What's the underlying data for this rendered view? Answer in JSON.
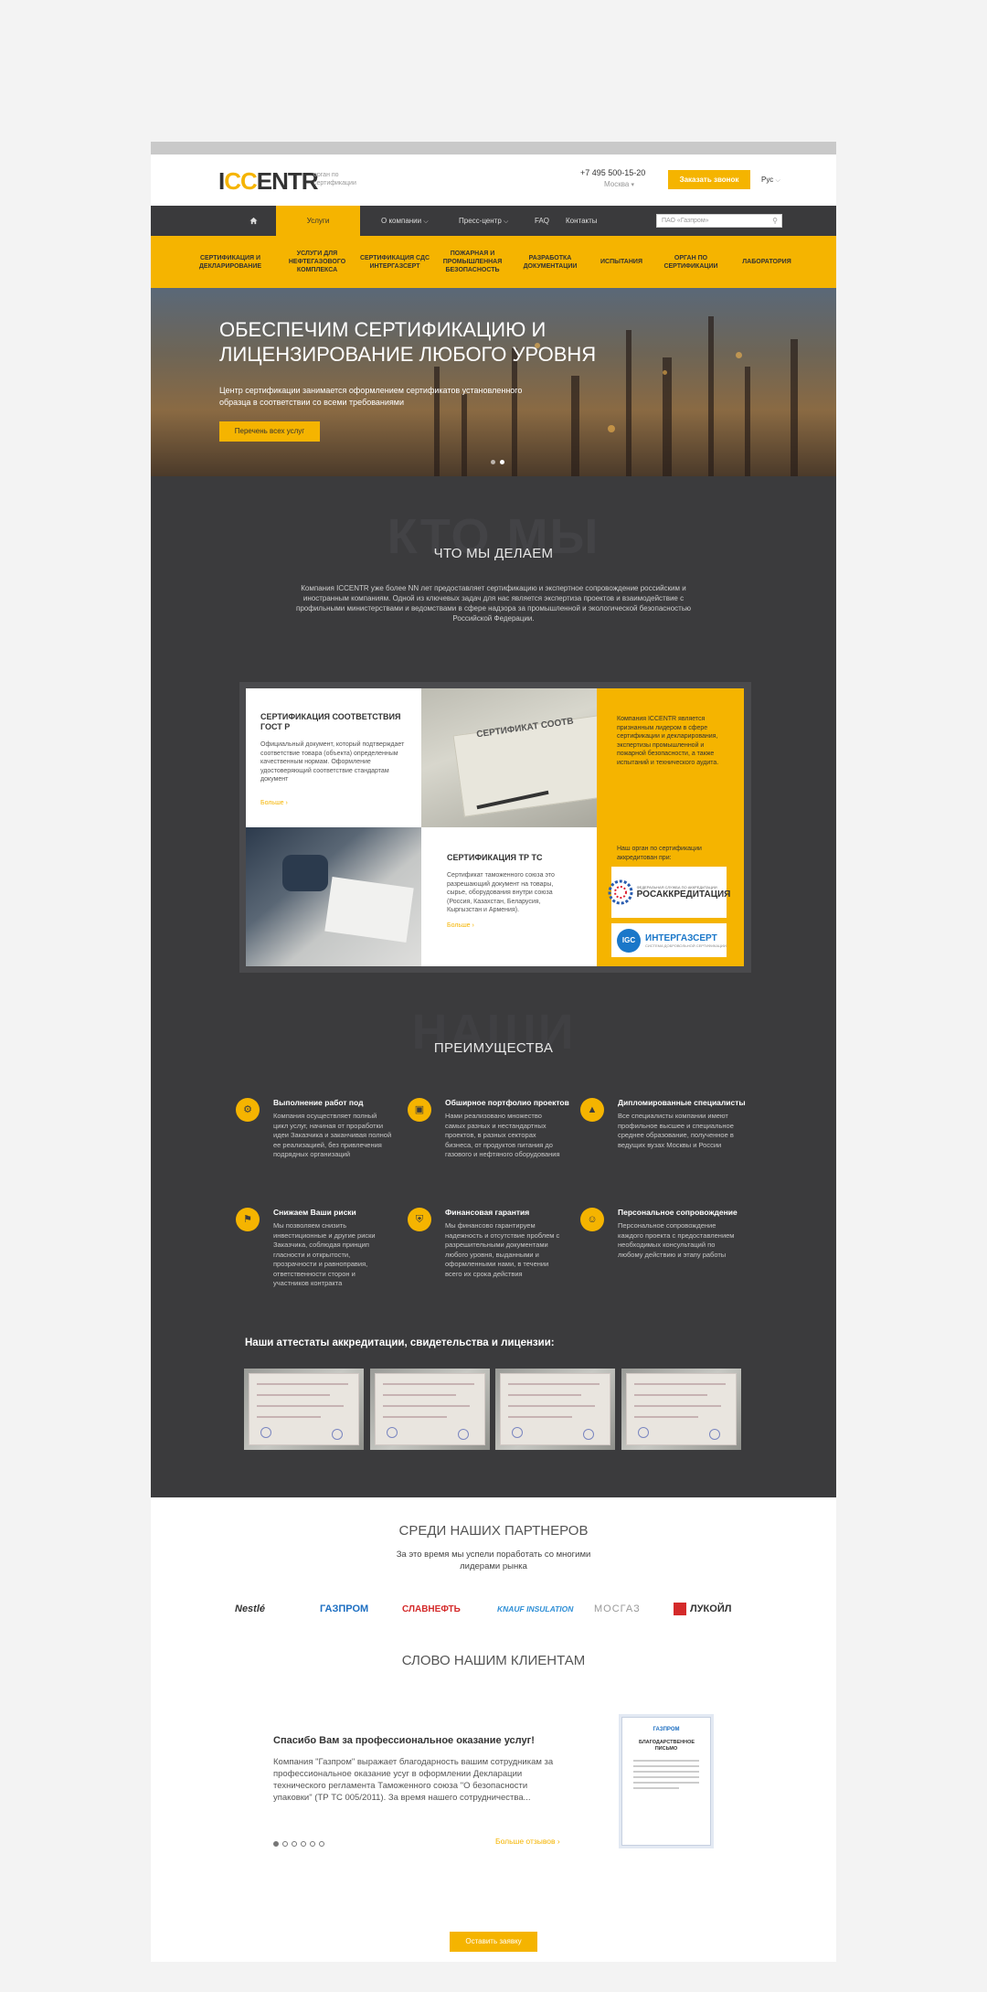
{
  "header": {
    "logo_text": "ICCENTR",
    "logo_sub": "орган по сертификации",
    "phone": "+7 495 500-15-20",
    "city": "Москва",
    "callback_label": "Заказать звонок",
    "lang": "Рус"
  },
  "nav": {
    "items": [
      {
        "label": "Услуги"
      },
      {
        "label": "О компании"
      },
      {
        "label": "Пресс-центр"
      },
      {
        "label": "FAQ"
      },
      {
        "label": "Контакты"
      }
    ],
    "search_placeholder": "ПАО «Газпром»"
  },
  "submenu": {
    "items": [
      {
        "label": "СЕРТИФИКАЦИЯ И ДЕКЛАРИРОВАНИЕ"
      },
      {
        "label": "УСЛУГИ ДЛЯ НЕФТЕГАЗОВОГО КОМПЛЕКСА"
      },
      {
        "label": "СЕРТИФИКАЦИЯ СДС ИНТЕРГАЗСЕРТ"
      },
      {
        "label": "ПОЖАРНАЯ И ПРОМЫШЛЕННАЯ БЕЗОПАСНОСТЬ"
      },
      {
        "label": "РАЗРАБОТКА ДОКУМЕНТАЦИИ"
      },
      {
        "label": "ИСПЫТАНИЯ"
      },
      {
        "label": "ОРГАН ПО СЕРТИФИКАЦИИ"
      },
      {
        "label": "ЛАБОРАТОРИЯ"
      }
    ]
  },
  "hero": {
    "title": "ОБЕСПЕЧИМ СЕРТИФИКАЦИЮ И ЛИЦЕНЗИРОВАНИЕ ЛЮБОГО УРОВНЯ",
    "text": "Центр сертификации занимается оформлением сертификатов установленного образца в соответствии со всеми требованиями",
    "button": "Перечень всех услуг"
  },
  "about": {
    "ghost": "КТО МЫ",
    "title": "ЧТО МЫ ДЕЛАЕМ",
    "intro": "Компания ICCENTR уже более NN лет предоставляет сертификацию и экспертное сопровождение российским и иностранным компаниям. Одной из ключевых задач для нас является экспертиза проектов и взаимодействие с профильными министерствами и ведомствами в сфере надзора за промышленной и экологической безопасностью Российской Федерации."
  },
  "services": {
    "card1": {
      "title": "СЕРТИФИКАЦИЯ СООТВЕТСТВИЯ ГОСТ Р",
      "text": "Официальный документ, который подтверждает соответствие товара (объекта) определенным качественным нормам. Оформление удостоверяющий соответствие стандартам документ",
      "more": "Больше"
    },
    "card2": {
      "title": "СЕРТИФИКАЦИЯ ТР ТС",
      "text": "Сертификат таможенного союза это разрешающий документ на товары, сырье, оборудования внутри союза (Россия, Казахстан, Беларусия, Кыргызстан и Армения).",
      "more": "Больше"
    },
    "doc_text": "СЕРТИФИКАТ СООТВ",
    "yellow_text": "Компания ICCENTR является признанным лидером в сфере сертификации и декларирования, экспертизы промышленной и пожарной безопасности, а также испытаний и технического аудита.",
    "accredited_text": "Наш орган по сертификации аккредитован при:",
    "logo1": "РОСАККРЕДИТАЦИЯ",
    "logo1_small": "ФЕДЕРАЛЬНАЯ СЛУЖБА ПО АККРЕДИТАЦИИ",
    "logo2": "ИНТЕРГАЗСЕРТ",
    "logo2_small": "СИСТЕМА ДОБРОВОЛЬНОЙ СЕРТИФИКАЦИИ",
    "logo2_badge": "IGC"
  },
  "advantages": {
    "ghost": "НАШИ",
    "title": "ПРЕИМУЩЕСТВА",
    "items": [
      {
        "title": "Выполнение работ под",
        "text": "Компания осуществляет полный цикл услуг, начиная от проработки идеи Заказчика и заканчивая полной ее реализацией, без привлечения подрядных организаций",
        "icon": "gear-icon"
      },
      {
        "title": "Обширное портфолио проектов",
        "text": "Нами реализовано множество самых разных и нестандартных проектов, в разных секторах бизнеса, от продуктов питания до газового и нефтяного оборудования",
        "icon": "briefcase-icon"
      },
      {
        "title": "Дипломированные специалисты",
        "text": "Все специалисты компании имеют профильное высшее и специальное среднее образование, полученное в ведущих вузах Москвы и России",
        "icon": "graduation-cap-icon"
      },
      {
        "title": "Снижаем Ваши риски",
        "text": "Мы позволяем снизить инвестиционные и другие риски Заказчика, соблюдая принцип гласности и открытости, прозрачности и равноправия, ответственности сторон и участников контракта",
        "icon": "flag-icon"
      },
      {
        "title": "Финансовая гарантия",
        "text": "Мы финансово гарантируем надежность и отсутствие проблем с разрешительными документами любого уровня, выданными и оформленными нами, в течении всего их срока действия",
        "icon": "shield-icon"
      },
      {
        "title": "Персональное сопровождение",
        "text": "Персональное сопровождение каждого проекта с предоставлением необходимых консультаций по любому действию и этапу работы",
        "icon": "person-badge-icon"
      }
    ]
  },
  "certificates": {
    "title": "Наши аттестаты аккредитации, свидетельства и лицензии:"
  },
  "partners": {
    "title": "СРЕДИ НАШИХ ПАРТНЕРОВ",
    "subtitle": "За это время мы успели поработать со многими лидерами рынка",
    "logos": [
      {
        "name": "Nestlé",
        "color": "#333333"
      },
      {
        "name": "ГАЗПРОМ",
        "color": "#1e6fc2"
      },
      {
        "name": "СЛАВНЕФТЬ",
        "color": "#d42a2a"
      },
      {
        "name": "KNAUF INSULATION",
        "color": "#2f8fd6"
      },
      {
        "name": "МОСГАЗ",
        "color": "#9a9a9a"
      },
      {
        "name": "ЛУКОЙЛ",
        "color": "#d42a2a"
      }
    ]
  },
  "reviews": {
    "title": "СЛОВО НАШИМ КЛИЕНТАМ",
    "head": "Спасибо Вам за профессиональное оказание услуг!",
    "text": "Компания \"Газпром\" выражает благодарность вашим сотрудникам за профессиональное оказание усуг в оформлении Декларации технического регламента Таможенного союза \"О безопасности упаковки\" (ТР ТС 005/2011). За время нашего сотрудничества...",
    "more": "Больше отзывов",
    "letter_title": "БЛАГОДАРСТВЕННОЕ ПИСЬМО",
    "letter_logo": "ГАЗПРОМ",
    "order_button": "Оставить заявку"
  }
}
